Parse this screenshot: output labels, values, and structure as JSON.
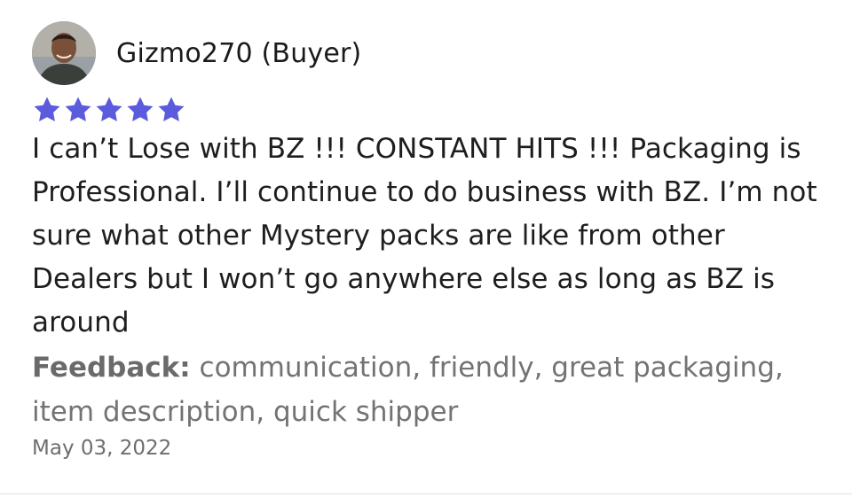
{
  "review": {
    "author": "Gizmo270 (Buyer)",
    "rating": 5,
    "rating_max": 5,
    "text": "I can’t Lose with BZ !!! CONSTANT HITS !!! Packaging is Professional. I’ll continue to do business with BZ. I’m not sure what other Mystery packs are like from other Dealers but I won’t go anywhere else as long as BZ is around",
    "feedback_label": "Feedback:",
    "feedback_tags": "communication, friendly, great packaging, item description, quick shipper",
    "date": "May 03, 2022"
  },
  "colors": {
    "star": "#5b5bde",
    "text": "#1e1e1e",
    "muted": "#737373"
  },
  "icons": {
    "avatar": "user-avatar-photo",
    "star": "star-icon"
  }
}
